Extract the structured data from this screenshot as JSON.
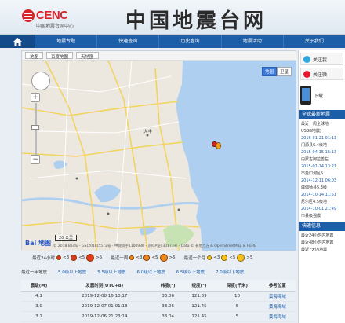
{
  "header": {
    "logo_text": "CENC",
    "logo_subtitle": "中国地震台网中心",
    "site_title": "中国地震台网"
  },
  "nav": {
    "items": [
      "地震专题",
      "快速查询",
      "历史查询",
      "地震活动",
      "关于我们"
    ]
  },
  "map": {
    "tabs": [
      "地图",
      "百度地图",
      "天地图"
    ],
    "type_buttons": [
      "地图",
      "卫星"
    ],
    "scale_label": "20 公里",
    "copyright": "© 2018 Baidu - GS(2018)5572号 - 甲测资字1100930 - 京ICP证030173号 - Data © 长地万方 & OpenStreetMap & HERE",
    "city_label": "大丰"
  },
  "legend": {
    "groups": [
      {
        "label": "最近24小时",
        "items": [
          "<3",
          "<5",
          ">5"
        ],
        "color": "#e23a1f"
      },
      {
        "label": "最近一周",
        "items": [
          "<3",
          "<5",
          ">5"
        ],
        "color": "#f08a1c"
      },
      {
        "label": "最近一个月",
        "items": [
          "<3",
          "<5",
          ">5"
        ],
        "color": "#f6c21a"
      }
    ]
  },
  "filter": {
    "items": [
      "最近一年地震",
      "5.0级以上地震",
      "5.5级以上地震",
      "6.0级以上地震",
      "6.5级以上地震",
      "7.0级以下地震"
    ]
  },
  "table": {
    "headers": [
      "震级(M)",
      "发震时刻(UTC+8)",
      "纬度(°)",
      "经度(°)",
      "深度(千米)",
      "参考位置"
    ],
    "rows": [
      [
        "4.1",
        "2019-12-08 16:10:17",
        "33.06",
        "121.39",
        "10",
        "黄海海域"
      ],
      [
        "3.0",
        "2019-12-07 01:01:18",
        "33.06",
        "121.45",
        "5",
        "黄海海域"
      ],
      [
        "3.1",
        "2019-12-06 21:23:14",
        "33.04",
        "121.45",
        "5",
        "黄海海域"
      ]
    ]
  },
  "side": {
    "follow": "关注我",
    "weibo": "关注微",
    "download": "下载",
    "bar1": "全球最新地震",
    "news": [
      {
        "date": "",
        "text": "最近一周全球地"
      },
      {
        "date": "",
        "text": "USGS地震)"
      },
      {
        "date": "2016-01-21 01:13",
        "text": "门源县6.4级地"
      },
      {
        "date": "2015-04-15 15:13",
        "text": "内蒙古阿拉善左"
      },
      {
        "date": "2015-01-14 13:21",
        "text": "市金口河区5."
      },
      {
        "date": "2014-12-11 06:03",
        "text": "疆伽师县5.3级"
      },
      {
        "date": "2014-10-14 11:51",
        "text": "尼尔区4.5级地"
      },
      {
        "date": "2014-10-01 21:49",
        "text": "市县级强震"
      }
    ],
    "bar2": "快速信息",
    "bottom": [
      "最近24小时内地震",
      "最近48小时内地震",
      "最近7天内地震"
    ]
  },
  "colors": {
    "nav": "#1d5ea8",
    "brand": "#d8232a",
    "quake_dot": "#d9261c"
  },
  "icons": [
    "home-icon",
    "zoom-in-icon",
    "zoom-out-icon",
    "pan-icon",
    "weibo-icon",
    "phone-icon"
  ]
}
